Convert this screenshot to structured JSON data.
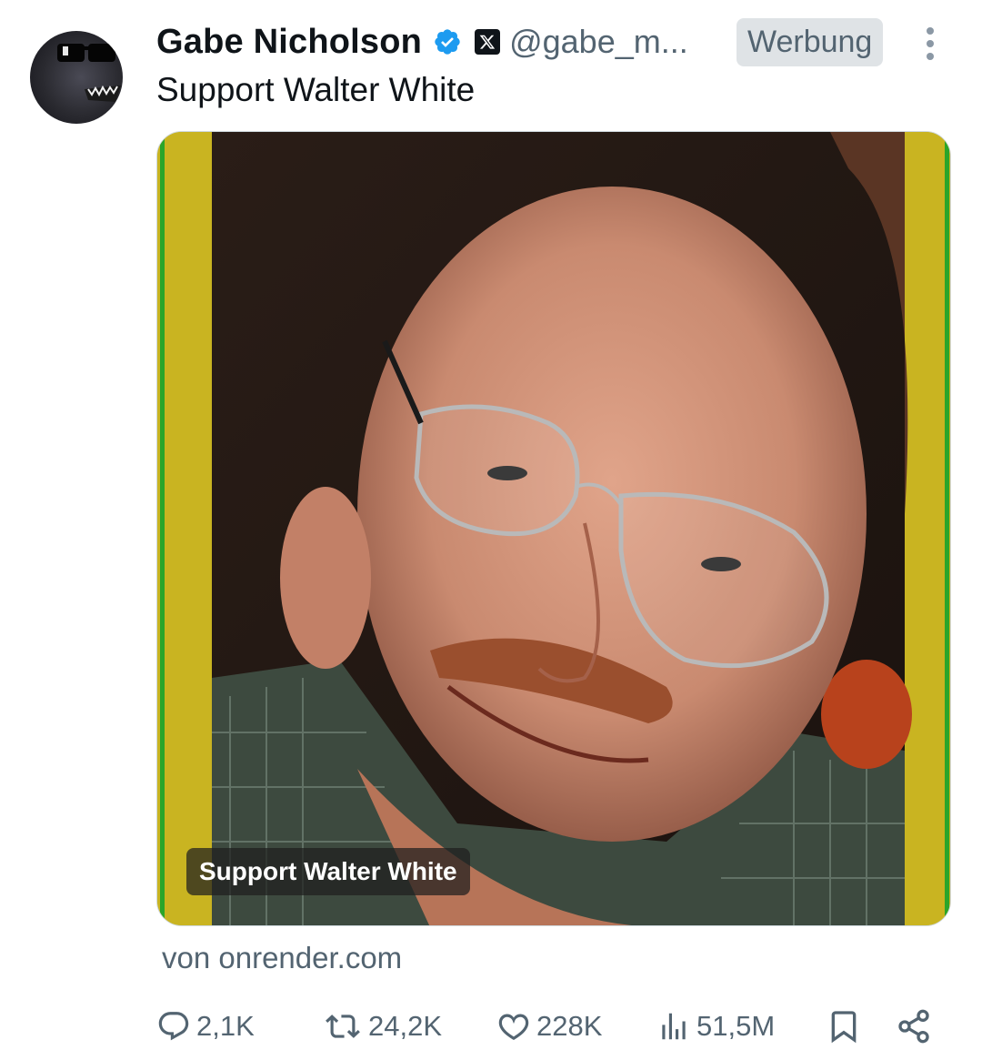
{
  "tweet": {
    "display_name": "Gabe Nicholson",
    "handle": "@gabe_m...",
    "ad_label": "Werbung",
    "text": "Support Walter White",
    "media_caption": "Support Walter White",
    "source_text": "von onrender.com"
  },
  "icons": {
    "verified": "verified-badge-icon",
    "x_logo": "x-logo-icon",
    "more": "more-vertical-icon",
    "reply": "reply-icon",
    "retweet": "retweet-icon",
    "like": "heart-icon",
    "views": "views-bar-chart-icon",
    "bookmark": "bookmark-icon",
    "share": "share-icon"
  },
  "metrics": {
    "replies": "2,1K",
    "retweets": "24,2K",
    "likes": "228K",
    "views": "51,5M"
  },
  "colors": {
    "verified_blue": "#1d9bf0",
    "text_primary": "#0f1419",
    "text_secondary": "#536471",
    "frame_yellow": "#c9b421",
    "frame_green": "#2aa52a"
  }
}
